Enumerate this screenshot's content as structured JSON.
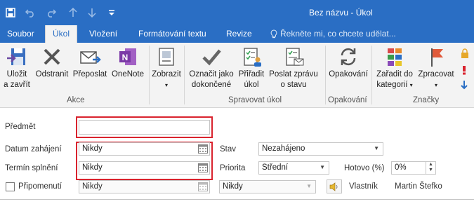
{
  "window": {
    "title": "Bez názvu - Úkol"
  },
  "colors": {
    "accent": "#2a6ec4",
    "highlight": "#d9232e"
  },
  "qat": [
    "save-icon",
    "undo-icon",
    "redo-icon",
    "up-arrow-icon",
    "down-arrow-icon",
    "customize-icon"
  ],
  "tabs": [
    {
      "label": "Soubor"
    },
    {
      "label": "Úkol"
    },
    {
      "label": "Vložení"
    },
    {
      "label": "Formátování textu"
    },
    {
      "label": "Revize"
    }
  ],
  "tellme": "Řekněte mi, co chcete udělat...",
  "ribbon": {
    "akce": {
      "label": "Akce",
      "save_close_l1": "Uložit",
      "save_close_l2": "a zavřít",
      "delete": "Odstranit",
      "forward": "Přeposlat",
      "onenote": "OneNote"
    },
    "show": {
      "label": "Zobrazit"
    },
    "manage": {
      "label": "Spravovat úkol",
      "mark_l1": "Označit jako",
      "mark_l2": "dokončené",
      "assign_l1": "Přiřadit",
      "assign_l2": "úkol",
      "send_l1": "Poslat zprávu",
      "send_l2": "o stavu"
    },
    "recurrence": {
      "label": "Opakování",
      "btn": "Opakování"
    },
    "tags": {
      "label": "Značky",
      "categorize_l1": "Zařadit do",
      "categorize_l2": "kategorií",
      "followup": "Zpracovat"
    }
  },
  "form": {
    "subject_label": "Předmět",
    "subject_value": "",
    "start_label": "Datum zahájení",
    "start_value": "Nikdy",
    "due_label": "Termín splnění",
    "due_value": "Nikdy",
    "status_label": "Stav",
    "status_value": "Nezahájeno",
    "priority_label": "Priorita",
    "priority_value": "Střední",
    "complete_label": "Hotovo (%)",
    "complete_value": "0%",
    "reminder_label": "Připomenutí",
    "reminder_date": "Nikdy",
    "reminder_time": "Nikdy",
    "owner_label": "Vlastník",
    "owner_value": "Martin Štefko"
  }
}
